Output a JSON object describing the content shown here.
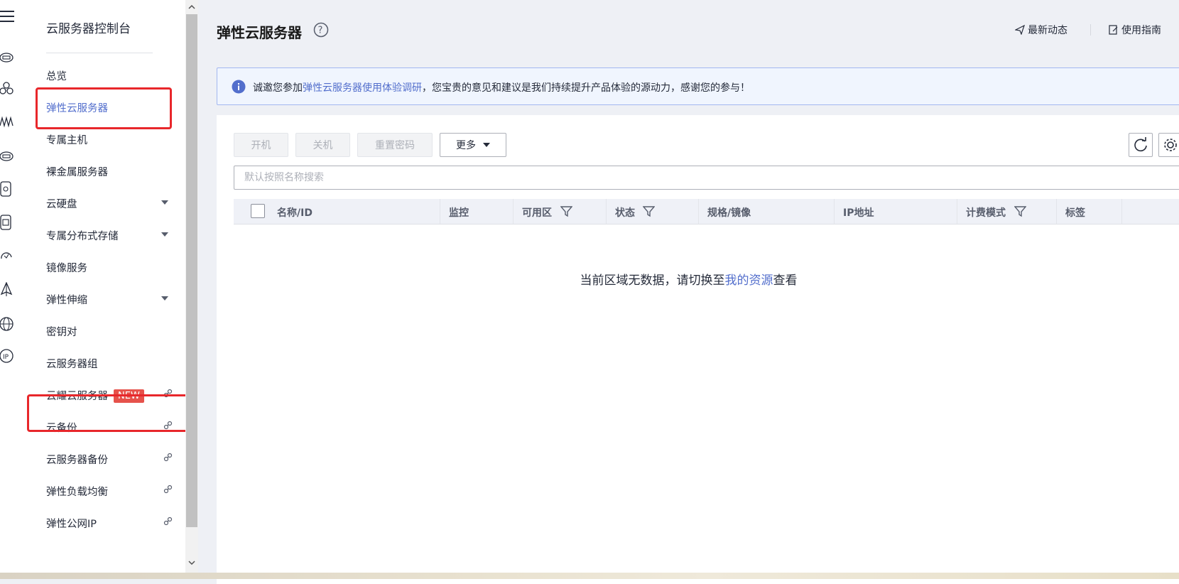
{
  "sidebar": {
    "title": "云服务器控制台",
    "items": [
      {
        "label": "总览",
        "caret": false,
        "external": false
      },
      {
        "label": "弹性云服务器",
        "caret": false,
        "external": false,
        "active": true
      },
      {
        "label": "专属主机",
        "caret": false,
        "external": false
      },
      {
        "label": "裸金属服务器",
        "caret": false,
        "external": false
      },
      {
        "label": "云硬盘",
        "caret": true,
        "external": false
      },
      {
        "label": "专属分布式存储",
        "caret": true,
        "external": false
      },
      {
        "label": "镜像服务",
        "caret": false,
        "external": false
      },
      {
        "label": "弹性伸缩",
        "caret": true,
        "external": false
      },
      {
        "label": "密钥对",
        "caret": false,
        "external": false
      },
      {
        "label": "云服务器组",
        "caret": false,
        "external": false
      },
      {
        "label": "云耀云服务器",
        "caret": false,
        "external": true,
        "badge": "NEW"
      },
      {
        "label": "云备份",
        "caret": false,
        "external": true
      },
      {
        "label": "云服务器备份",
        "caret": false,
        "external": true
      },
      {
        "label": "弹性负载均衡",
        "caret": false,
        "external": true
      },
      {
        "label": "弹性公网IP",
        "caret": false,
        "external": true
      }
    ]
  },
  "rail_icons": [
    "menu-icon",
    "cloud-server-icon",
    "cluster-icon",
    "waveform-icon",
    "disk-icon",
    "storage-icon",
    "dedicated-storage-icon",
    "cloud-refresh-icon",
    "sail-icon",
    "globe-icon",
    "ip-icon"
  ],
  "header": {
    "title": "弹性云服务器",
    "links": {
      "news": "最新动态",
      "guide": "使用指南"
    }
  },
  "notice": {
    "prefix": "诚邀您参加",
    "link": "弹性云服务器使用体验调研",
    "suffix": "，您宝贵的意见和建议是我们持续提升产品体验的源动力，感谢您的参与！"
  },
  "toolbar": {
    "start": "开机",
    "stop": "关机",
    "reset_password": "重置密码",
    "more": "更多"
  },
  "search": {
    "placeholder": "默认按照名称搜索"
  },
  "table": {
    "columns": [
      "名称/ID",
      "监控",
      "可用区",
      "状态",
      "规格/镜像",
      "IP地址",
      "计费模式",
      "标签"
    ],
    "rows": []
  },
  "empty": {
    "prefix": "当前区域无数据，请切换至",
    "link": "我的资源",
    "suffix": "查看"
  },
  "colors": {
    "accent": "#526ecc",
    "highlight": "#e8272b",
    "badge": "#e6524b"
  }
}
